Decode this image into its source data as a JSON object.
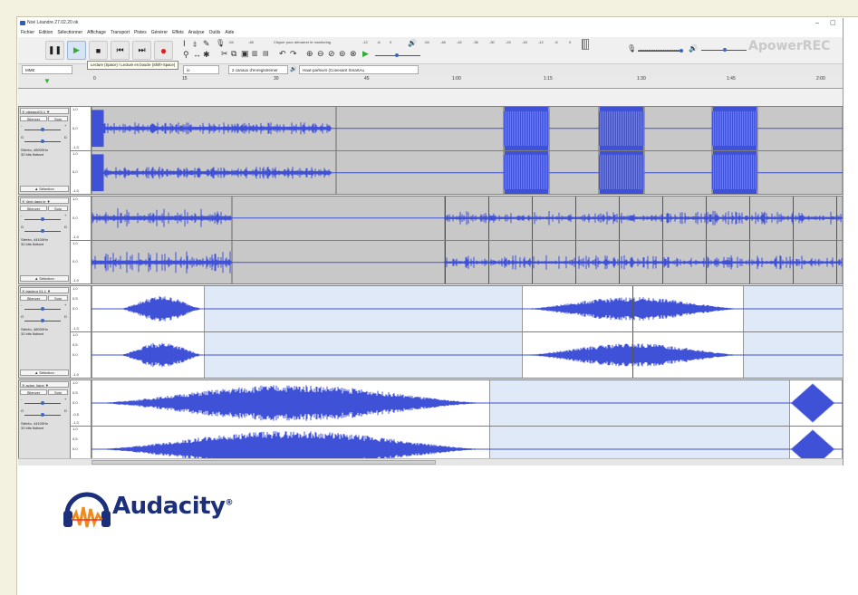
{
  "window": {
    "title": "Noé Léandre 27.02.20 ok",
    "controls": [
      "–",
      "▢"
    ]
  },
  "menu": [
    "Fichier",
    "Edition",
    "Sélectionner",
    "Affichage",
    "Transport",
    "Pistes",
    "Générer",
    "Effets",
    "Analyse",
    "Outils",
    "Aide"
  ],
  "toolbar": {
    "pause": "❚❚",
    "play": "▶",
    "stop": "■",
    "skip_start": "⏮",
    "skip_end": "⏭",
    "record": "●",
    "monitor_hint": "Cliquer pour démarrer le monitoring",
    "meter_record_ticks": [
      "-54",
      "-48",
      "-12",
      "-6",
      "0"
    ],
    "meter_play_ticks": [
      "-54",
      "-48",
      "-42",
      "-36",
      "-30",
      "-24",
      "-18",
      "-12",
      "-6",
      "0"
    ],
    "tooltip": "Lecture (Space) / Lecture en boucle (Shift+Space)"
  },
  "devices": {
    "host": "MME",
    "recording_device": "io",
    "channels": "2 canaux d'enregistremer",
    "playback_device": "Haut-parleurs (Conexant SmartAu"
  },
  "ruler": {
    "ticks": [
      "0",
      "15",
      "30",
      "45",
      "1:00",
      "1:15",
      "1:30",
      "1:45",
      "2:00"
    ]
  },
  "tracks": [
    {
      "name": "oiseaux03.1",
      "format": "Stéréo, 48000Hz",
      "bits": "32 bits flottant",
      "mute": "Silencer",
      "solo": "Solo",
      "select": "Sélection",
      "scale_top": "1,0",
      "scale_mid": "0,0",
      "scale_bottom": "-1,0",
      "gain_min": "-",
      "gain_max": "+",
      "pan_left": "G",
      "pan_right": "D"
    },
    {
      "name": "Vent dans le",
      "format": "Stéréo, 44100Hz",
      "bits": "32 bits flottant",
      "mute": "Silencer",
      "solo": "Solo",
      "select": "Sélection",
      "scale_top": "1,0",
      "scale_mid": "0,0",
      "scale_bottom": "-1,0",
      "gain_min": "-",
      "gain_max": "+",
      "pan_left": "G",
      "pan_right": "D"
    },
    {
      "name": "tracteur 01.1",
      "format": "Stéréo, 48000Hz",
      "bits": "32 bits flottant",
      "mute": "Silencer",
      "solo": "Solo",
      "select": "Sélection",
      "scale_top": "1,0",
      "scale_mid": "0,0",
      "scale_bottom": "-1,0",
      "scale_half": "0,5",
      "gain_min": "-",
      "gain_max": "+",
      "pan_left": "G",
      "pan_right": "D"
    },
    {
      "name": "avion_ligne",
      "format": "Stéréo, 44100Hz",
      "bits": "32 bits flottant",
      "mute": "Silencer",
      "solo": "Solo",
      "select": "Sélection",
      "scale_top": "1,0",
      "scale_mid": "0,0",
      "scale_bottom": "-1,0",
      "scale_half": "0,5",
      "scale_neg_half": "-0,5",
      "gain_min": "-",
      "gain_max": "+",
      "pan_left": "G",
      "pan_right": "D"
    }
  ],
  "watermark": "ApowerREC",
  "logo": {
    "name": "Audacity",
    "reg": "®"
  },
  "colors": {
    "wave": "#3f51d6",
    "clip_bg": "#c8c8c8",
    "clip_selected": "#dfe9f8",
    "track_bg": "#7f7f7f"
  }
}
